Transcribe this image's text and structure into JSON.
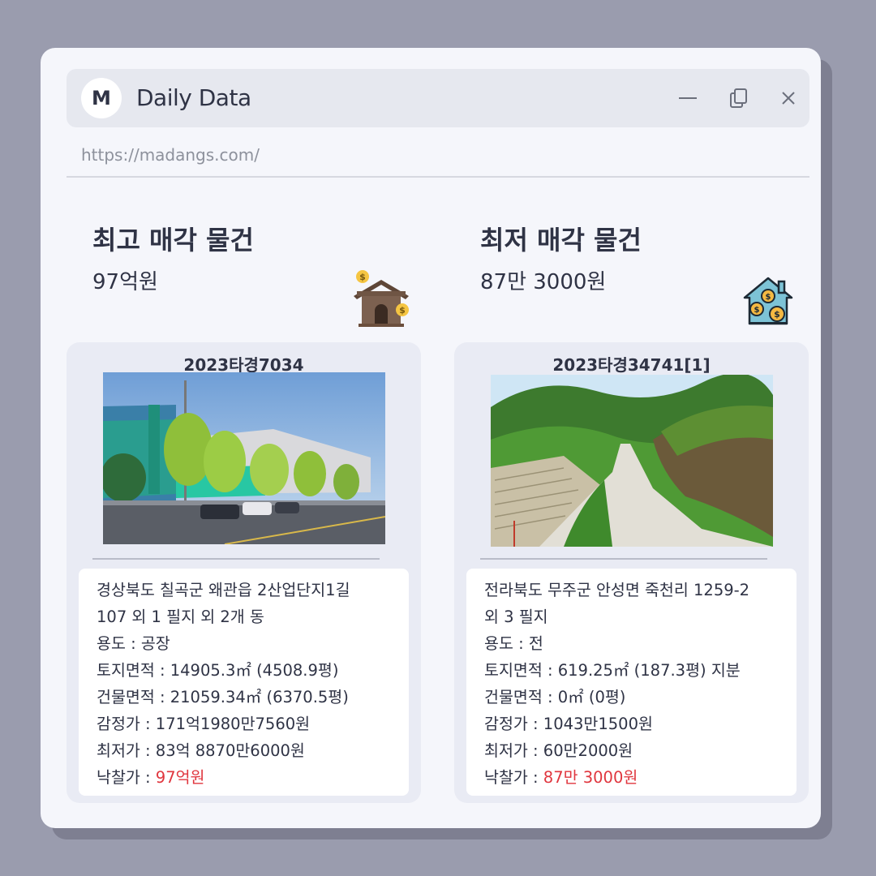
{
  "app": {
    "logo_letter": "M",
    "title": "Daily Data",
    "url": "https://madangs.com/"
  },
  "highest": {
    "section_title": "최고 매각 물건",
    "price": "97억원",
    "case_no": "2023타경7034",
    "address_line1": "경상북도 칠곡군 왜관읍 2산업단지1길",
    "address_line2": "107 외 1 필지 외 2개 동",
    "usage": "용도 : 공장",
    "land_area": "토지면적 : 14905.3㎡ (4508.9평)",
    "building_area": "건물면적 : 21059.34㎡ (6370.5평)",
    "appraisal": "감정가 : 171억1980만7560원",
    "minimum": "최저가 : 83억 8870만6000원",
    "winning_label": "낙찰가 : ",
    "winning_value": "97억원"
  },
  "lowest": {
    "section_title": "최저 매각 물건",
    "price": "87만 3000원",
    "case_no": "2023타경34741[1]",
    "address_line1": "전라북도 무주군 안성면 죽천리 1259-2",
    "address_line2": "외 3 필지",
    "usage": "용도 : 전",
    "land_area": "토지면적 : 619.25㎡ (187.3평) 지분",
    "building_area": "건물면적 : 0㎡ (0평)",
    "appraisal": "감정가 : 1043만1500원",
    "minimum": "최저가 : 60만2000원",
    "winning_label": "낙찰가 : ",
    "winning_value": "87만 3000원"
  },
  "colors": {
    "accent_red": "#e0363e",
    "text": "#2f3345",
    "background": "#9a9cae"
  }
}
